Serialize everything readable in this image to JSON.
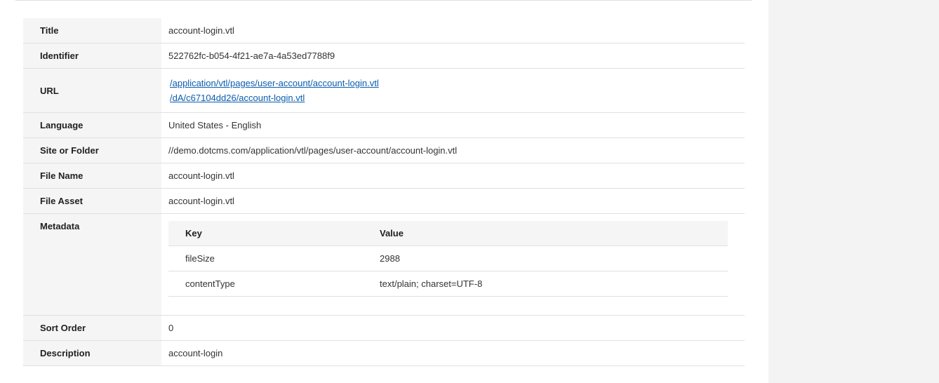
{
  "properties": {
    "title": {
      "label": "Title",
      "value": "account-login.vtl"
    },
    "identifier": {
      "label": "Identifier",
      "value": "522762fc-b054-4f21-ae7a-4a53ed7788f9"
    },
    "url": {
      "label": "URL",
      "links": [
        "/application/vtl/pages/user-account/account-login.vtl",
        "/dA/c67104dd26/account-login.vtl"
      ]
    },
    "language": {
      "label": "Language",
      "value": "United States - English"
    },
    "site_or_folder": {
      "label": "Site or Folder",
      "value": "//demo.dotcms.com/application/vtl/pages/user-account/account-login.vtl"
    },
    "file_name": {
      "label": "File Name",
      "value": "account-login.vtl"
    },
    "file_asset": {
      "label": "File Asset",
      "value": "account-login.vtl"
    },
    "metadata": {
      "label": "Metadata",
      "headers": {
        "key": "Key",
        "value": "Value"
      },
      "rows": [
        {
          "key": "fileSize",
          "value": "2988"
        },
        {
          "key": "contentType",
          "value": "text/plain; charset=UTF-8"
        }
      ]
    },
    "sort_order": {
      "label": "Sort Order",
      "value": "0"
    },
    "description": {
      "label": "Description",
      "value": "account-login"
    }
  }
}
